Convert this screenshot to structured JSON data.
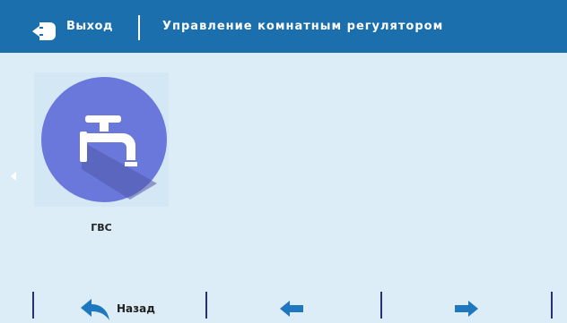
{
  "header": {
    "exit_label": "Выход",
    "title": "Управление комнатным регулятором"
  },
  "tiles": [
    {
      "label": "ГВС",
      "icon": "faucet-icon"
    }
  ],
  "footer": {
    "back_label": "Назад"
  },
  "colors": {
    "header_bg": "#1b6fad",
    "page_bg": "#dcedf8",
    "icon_circle": "#6b78db",
    "accent_arrow": "#1f77c0"
  }
}
